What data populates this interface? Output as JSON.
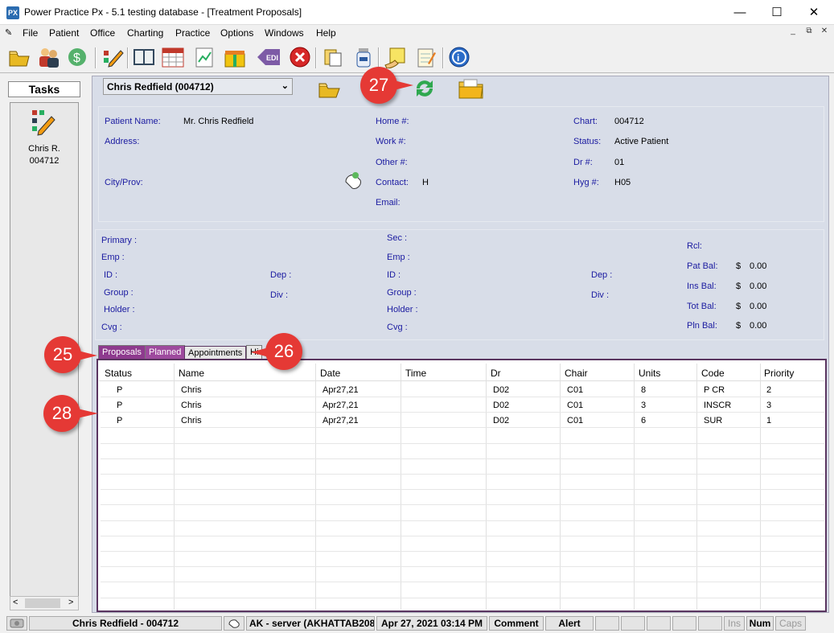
{
  "window": {
    "logo_text": "PX",
    "title": "Power Practice Px - 5.1 testing database - [Treatment Proposals]",
    "minimize": "—",
    "maximize": "☐",
    "close": "✕"
  },
  "menu": [
    "File",
    "Patient",
    "Office",
    "Charting",
    "Practice",
    "Options",
    "Windows",
    "Help"
  ],
  "mdi_controls": [
    "_",
    "⧉",
    "✕"
  ],
  "toolbar_icons": [
    "open-folder-icon",
    "patients-icon",
    "money-cycle-icon",
    "chart-pencil-icon",
    "book-icon",
    "calendar-icon",
    "clipboard-chart-icon",
    "gift-box-icon",
    "edi-icon",
    "cancel-icon",
    "documents-icon",
    "medication-icon",
    "note-hand-icon",
    "notepad-icon",
    "info-icon"
  ],
  "tasks": {
    "header": "Tasks",
    "item_name": "Chris R.",
    "item_id": "004712",
    "scroll_left": "<",
    "scroll_right": ">"
  },
  "patient_select": {
    "value": "Chris Redfield (004712)",
    "arrow": "⌄"
  },
  "patient_info": {
    "name_label": "Patient Name:",
    "name_value": "Mr. Chris Redfield",
    "address_label": "Address:",
    "city_label": "City/Prov:",
    "home_label": "Home #:",
    "work_label": "Work #:",
    "other_label": "Other #:",
    "contact_label": "Contact:",
    "contact_value": "H",
    "email_label": "Email:",
    "chart_label": "Chart:",
    "chart_value": "004712",
    "status_label": "Status:",
    "status_value": "Active Patient",
    "dr_label": "Dr #:",
    "dr_value": "01",
    "hyg_label": "Hyg #:",
    "hyg_value": "H05"
  },
  "insurance": {
    "primary": "Primary :",
    "emp1": "Emp :",
    "id1": "ID :",
    "dep1": "Dep :",
    "group1": "Group :",
    "div1": "Div :",
    "holder1": "Holder :",
    "cvg1": "Cvg :",
    "sec": "Sec :",
    "emp2": "Emp :",
    "id2": "ID :",
    "dep2": "Dep :",
    "group2": "Group :",
    "div2": "Div :",
    "holder2": "Holder :",
    "cvg2": "Cvg :"
  },
  "balances": {
    "rcl_label": "Rcl:",
    "pat_label": "Pat Bal:",
    "pat_cur": "$",
    "pat_value": "0.00",
    "ins_label": "Ins Bal:",
    "ins_cur": "$",
    "ins_value": "0.00",
    "tot_label": "Tot Bal:",
    "tot_cur": "$",
    "tot_value": "0.00",
    "pln_label": "Pln Bal:",
    "pln_cur": "$",
    "pln_value": "0.00"
  },
  "tabs": {
    "proposals": "Proposals",
    "planned": "Planned",
    "appointments": "Appointments",
    "history": "Hi"
  },
  "grid": {
    "columns": [
      "Status",
      "Name",
      "Date",
      "Time",
      "Dr",
      "Chair",
      "Units",
      "Code",
      "Priority"
    ],
    "rows": [
      [
        "P",
        "Chris",
        "Apr27,21",
        "",
        "D02",
        "C01",
        "8",
        "P CR",
        "2"
      ],
      [
        "P",
        "Chris",
        "Apr27,21",
        "",
        "D02",
        "C01",
        "3",
        "INSCR",
        "3"
      ],
      [
        "P",
        "Chris",
        "Apr27,21",
        "",
        "D02",
        "C01",
        "6",
        "SUR",
        "1"
      ]
    ]
  },
  "callouts": {
    "c25": "25",
    "c26": "26",
    "c27": "27",
    "c28": "28"
  },
  "statusbar": {
    "patient": "Chris Redfield - 004712",
    "server": "AK - server (AKHATTAB208",
    "datetime": "Apr 27, 2021 03:14 PM",
    "comment": "Comment",
    "alert": "Alert",
    "ins": "Ins",
    "num": "Num",
    "caps": "Caps"
  },
  "colors": {
    "panel_bg": "#d8dde8",
    "label_blue": "#1a1aa0",
    "tab_purple": "#8e3a8e",
    "callout_red": "#e53935"
  }
}
